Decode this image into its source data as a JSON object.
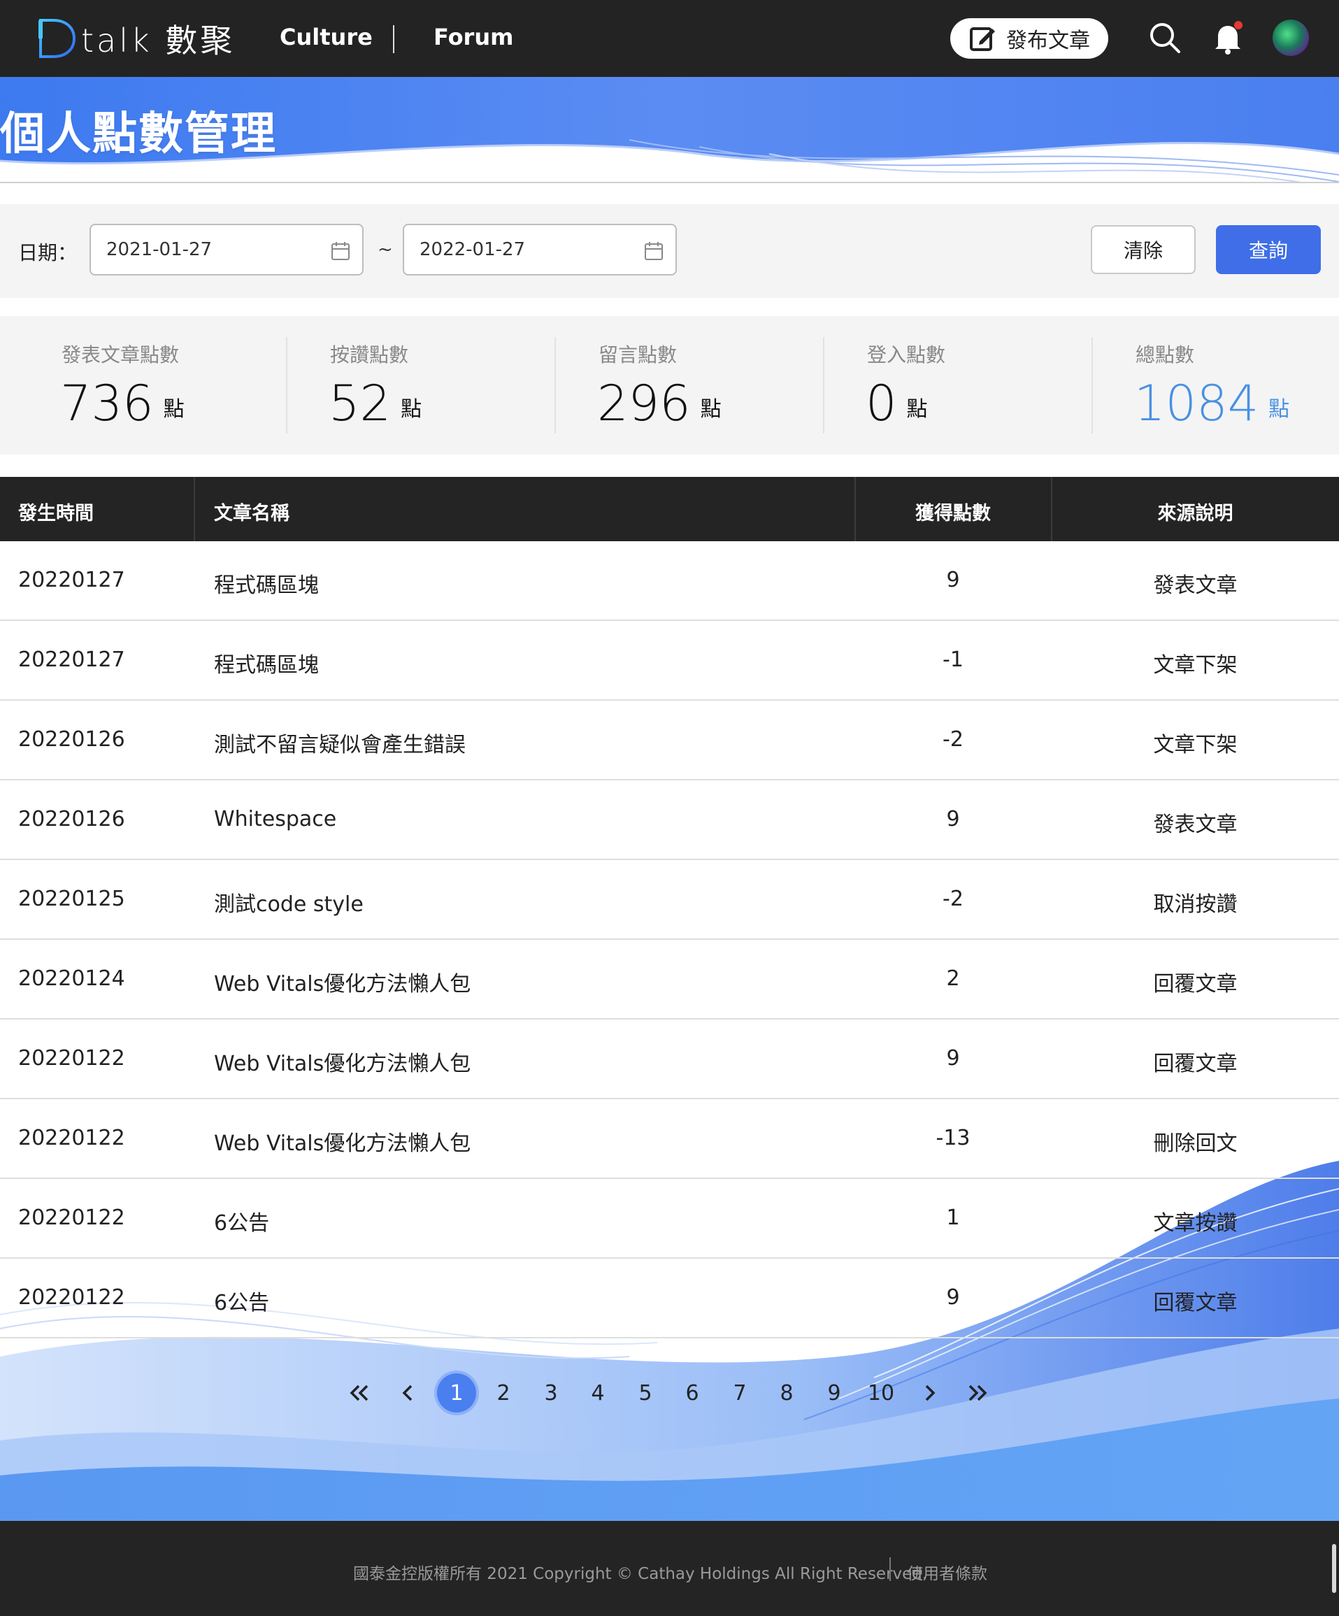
{
  "nav": {
    "logo_text": "talk 數聚",
    "links": [
      "Culture",
      "Forum"
    ],
    "post_button": "發布文章"
  },
  "page_title": "個人點數管理",
  "filter": {
    "label": "日期：",
    "start_date": "2021-01-27",
    "separator": "~",
    "end_date": "2022-01-27",
    "clear_label": "清除",
    "query_label": "查詢"
  },
  "stats": [
    {
      "label": "發表文章點數",
      "value": "736",
      "unit": "點"
    },
    {
      "label": "按讚點數",
      "value": "52",
      "unit": "點"
    },
    {
      "label": "留言點數",
      "value": "296",
      "unit": "點"
    },
    {
      "label": "登入點數",
      "value": "0",
      "unit": "點"
    },
    {
      "label": "總點數",
      "value": "1084",
      "unit": "點"
    }
  ],
  "table": {
    "headers": [
      "發生時間",
      "文章名稱",
      "獲得點數",
      "來源說明"
    ],
    "rows": [
      {
        "date": "20220127",
        "title": "程式碼區塊",
        "points": "9",
        "source": "發表文章"
      },
      {
        "date": "20220127",
        "title": "程式碼區塊",
        "points": "-1",
        "source": "文章下架"
      },
      {
        "date": "20220126",
        "title": "測試不留言疑似會產生錯誤",
        "points": "-2",
        "source": "文章下架"
      },
      {
        "date": "20220126",
        "title": "Whitespace",
        "points": "9",
        "source": "發表文章"
      },
      {
        "date": "20220125",
        "title": "測試code style",
        "points": "-2",
        "source": "取消按讚"
      },
      {
        "date": "20220124",
        "title": "Web Vitals優化方法懶人包",
        "points": "2",
        "source": "回覆文章"
      },
      {
        "date": "20220122",
        "title": "Web Vitals優化方法懶人包",
        "points": "9",
        "source": "回覆文章"
      },
      {
        "date": "20220122",
        "title": "Web Vitals優化方法懶人包",
        "points": "-13",
        "source": "刪除回文"
      },
      {
        "date": "20220122",
        "title": "6公告",
        "points": "1",
        "source": "文章按讚"
      },
      {
        "date": "20220122",
        "title": "6公告",
        "points": "9",
        "source": "回覆文章"
      }
    ]
  },
  "pagination": {
    "pages": [
      "1",
      "2",
      "3",
      "4",
      "5",
      "6",
      "7",
      "8",
      "9",
      "10"
    ],
    "current": "1"
  },
  "footer": {
    "copyright": "國泰金控版權所有 2021 Copyright © Cathay Holdings All Right Reserved.",
    "terms_link": "使用者條款"
  },
  "colors": {
    "primary": "#3f6ee8",
    "total_points": "#4a90e2",
    "topbar": "#232323",
    "notification_dot": "#e53935"
  },
  "icons": [
    "edit-icon",
    "search-icon",
    "bell-icon",
    "calendar-icon",
    "double-chevron-left-icon",
    "chevron-left-icon",
    "chevron-right-icon",
    "double-chevron-right-icon"
  ]
}
